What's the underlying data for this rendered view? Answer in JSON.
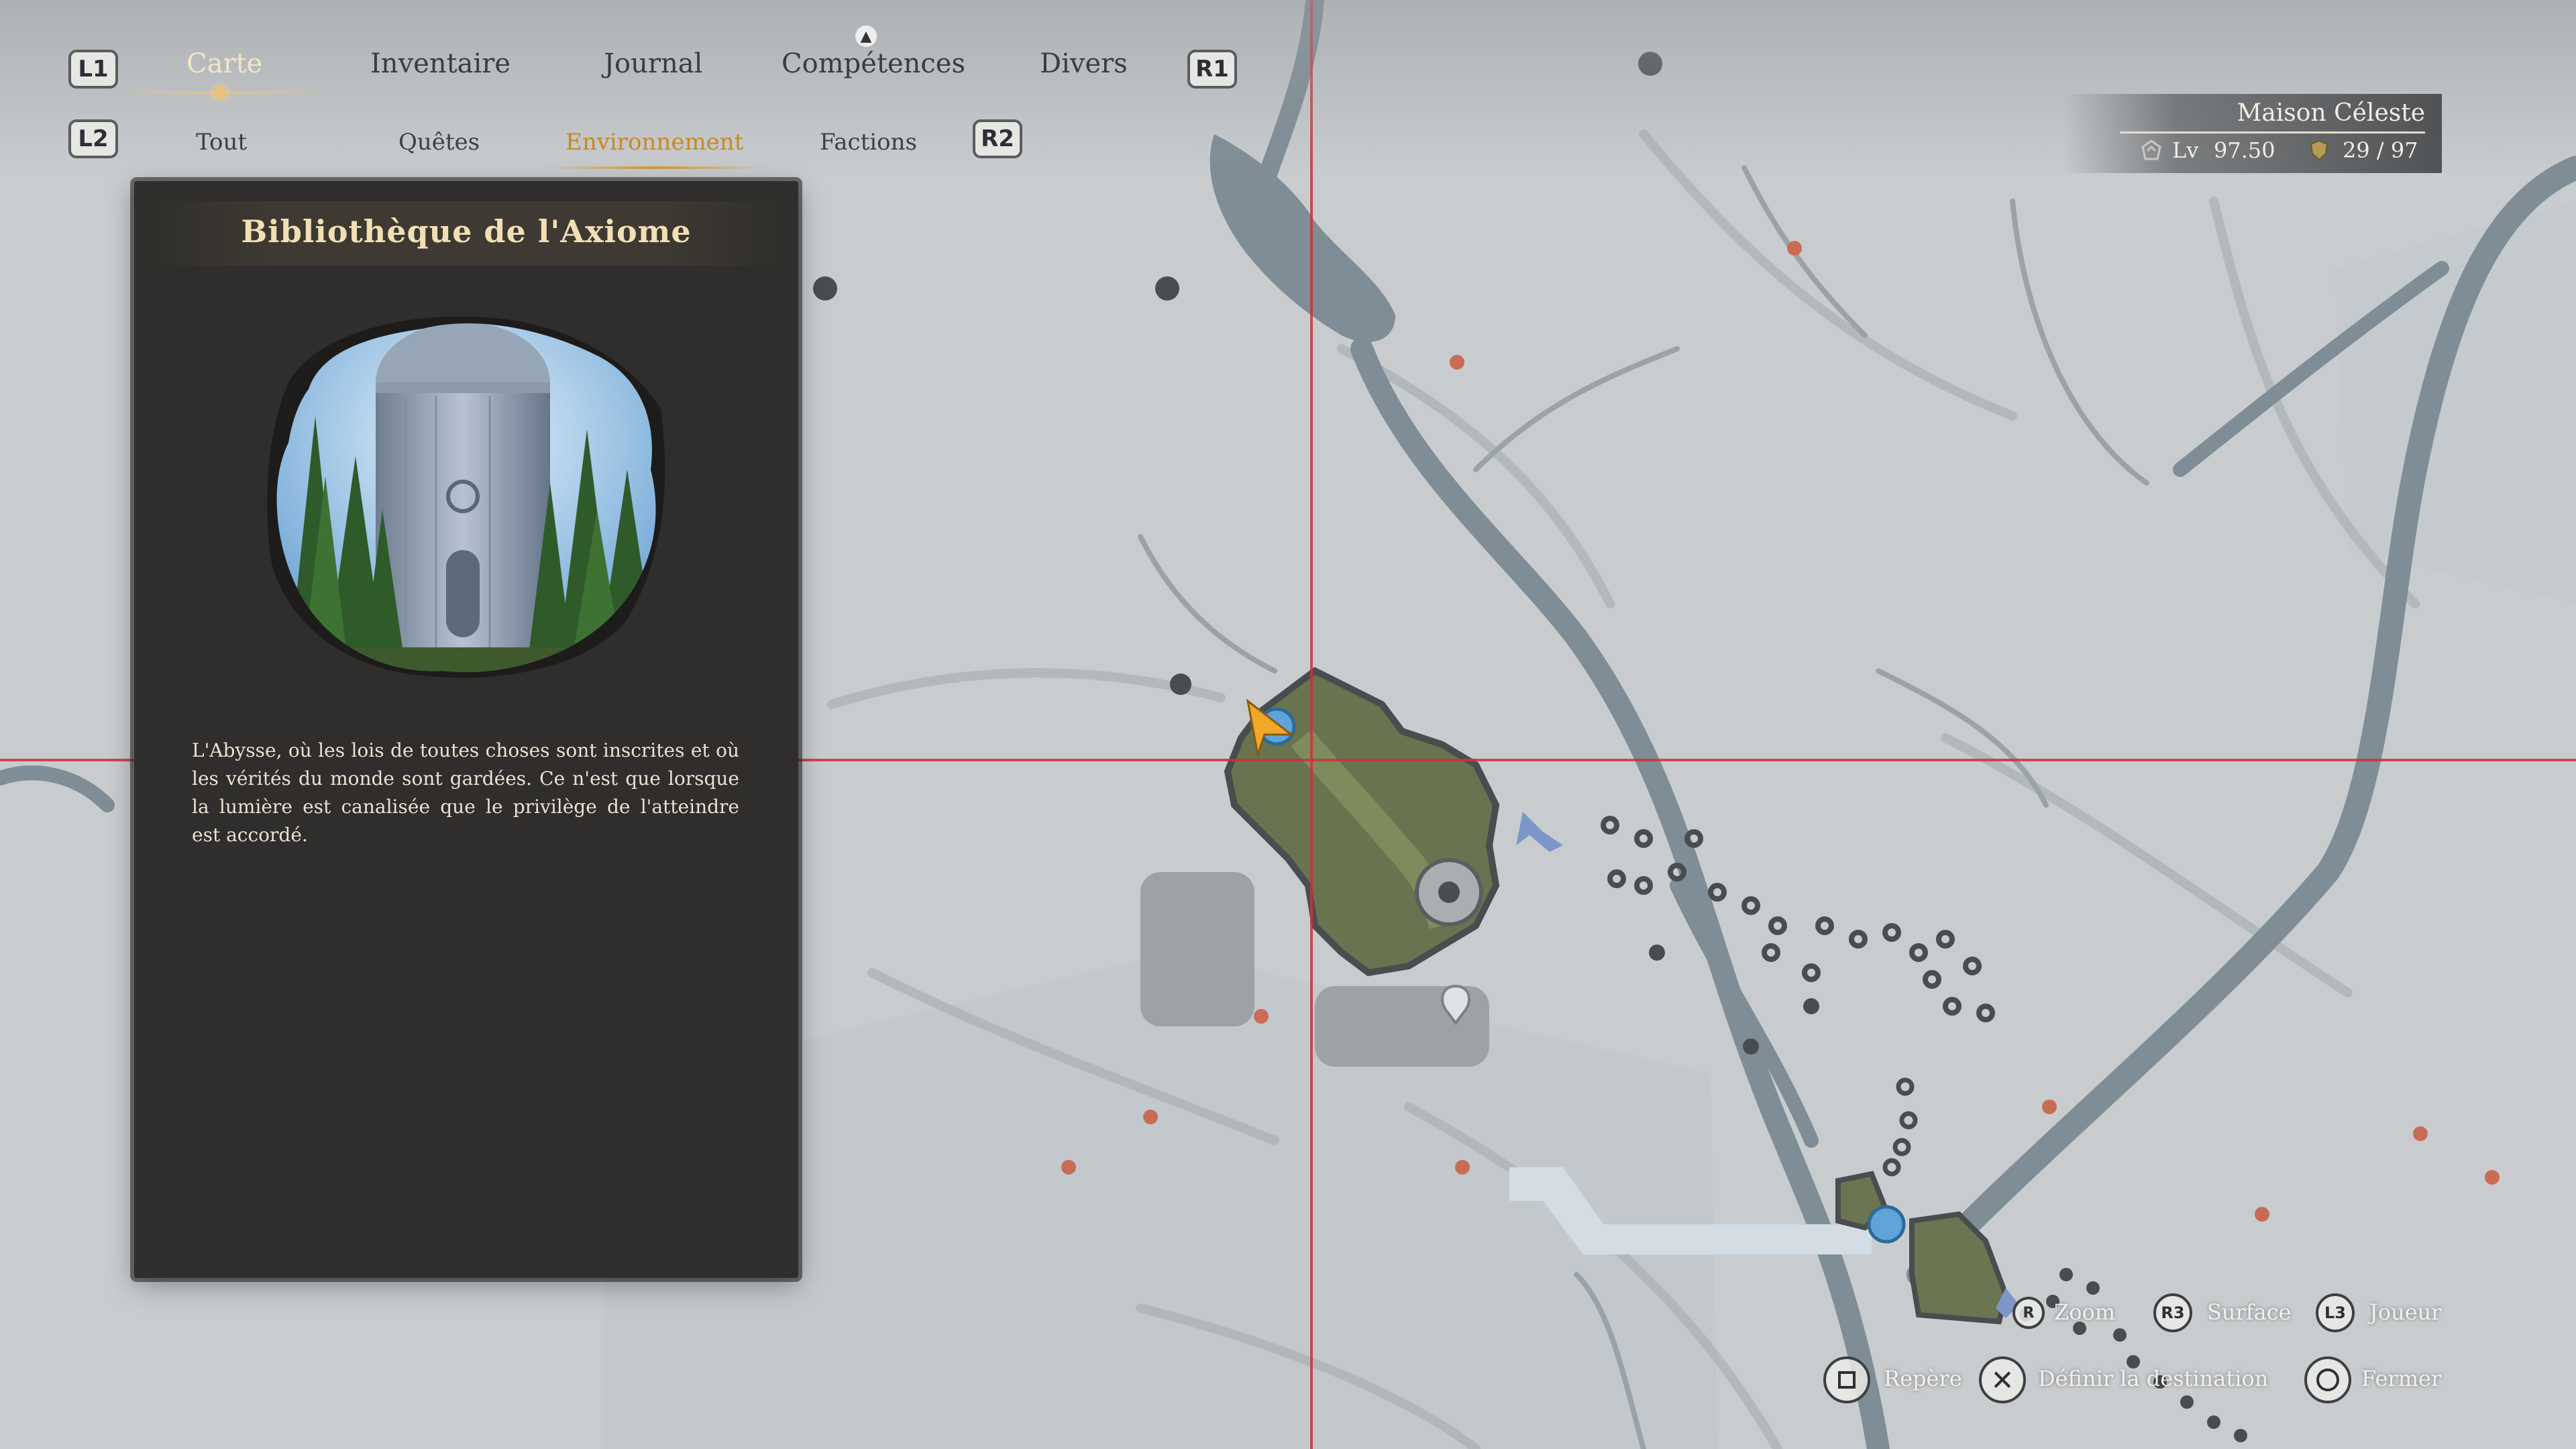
{
  "nav": {
    "left_bumper": "L1",
    "right_bumper": "R1",
    "left_trigger": "L2",
    "right_trigger": "R2",
    "tabs": [
      {
        "label": "Carte",
        "active": true
      },
      {
        "label": "Inventaire",
        "active": false
      },
      {
        "label": "Journal",
        "active": false
      },
      {
        "label": "Compétences",
        "active": false
      },
      {
        "label": "Divers",
        "active": false
      }
    ],
    "subtabs": [
      {
        "label": "Tout",
        "active": false
      },
      {
        "label": "Quêtes",
        "active": false
      },
      {
        "label": "Environnement",
        "active": true
      },
      {
        "label": "Factions",
        "active": false
      }
    ]
  },
  "panel": {
    "title": "Bibliothèque de l'Axiome",
    "description": "L'Abysse, où les lois de toutes choses sont inscrites et où les vérités du monde sont gardées. Ce n'est que lorsque la lumière est canalisée que le privilège de l'atteindre est accordé."
  },
  "player": {
    "name": "Maison Céleste",
    "level_label": "Lv",
    "level": "97.50",
    "progress": "29 / 97"
  },
  "controls": [
    {
      "key": "R",
      "label": "Zoom"
    },
    {
      "key": "R3",
      "label": "Surface"
    },
    {
      "key": "L3",
      "label": "Joueur"
    },
    {
      "key": "square",
      "label": "Repère"
    },
    {
      "key": "cross",
      "label": "Définir la destination"
    },
    {
      "key": "circle",
      "label": "Fermer"
    }
  ],
  "colors": {
    "map_background": "#c9ccce",
    "river": "#7b8a94",
    "active_tab": "#f3e6c6",
    "active_subtab": "#c58a22",
    "crosshair": "#c8333a",
    "panel": "#2f2e2c"
  }
}
